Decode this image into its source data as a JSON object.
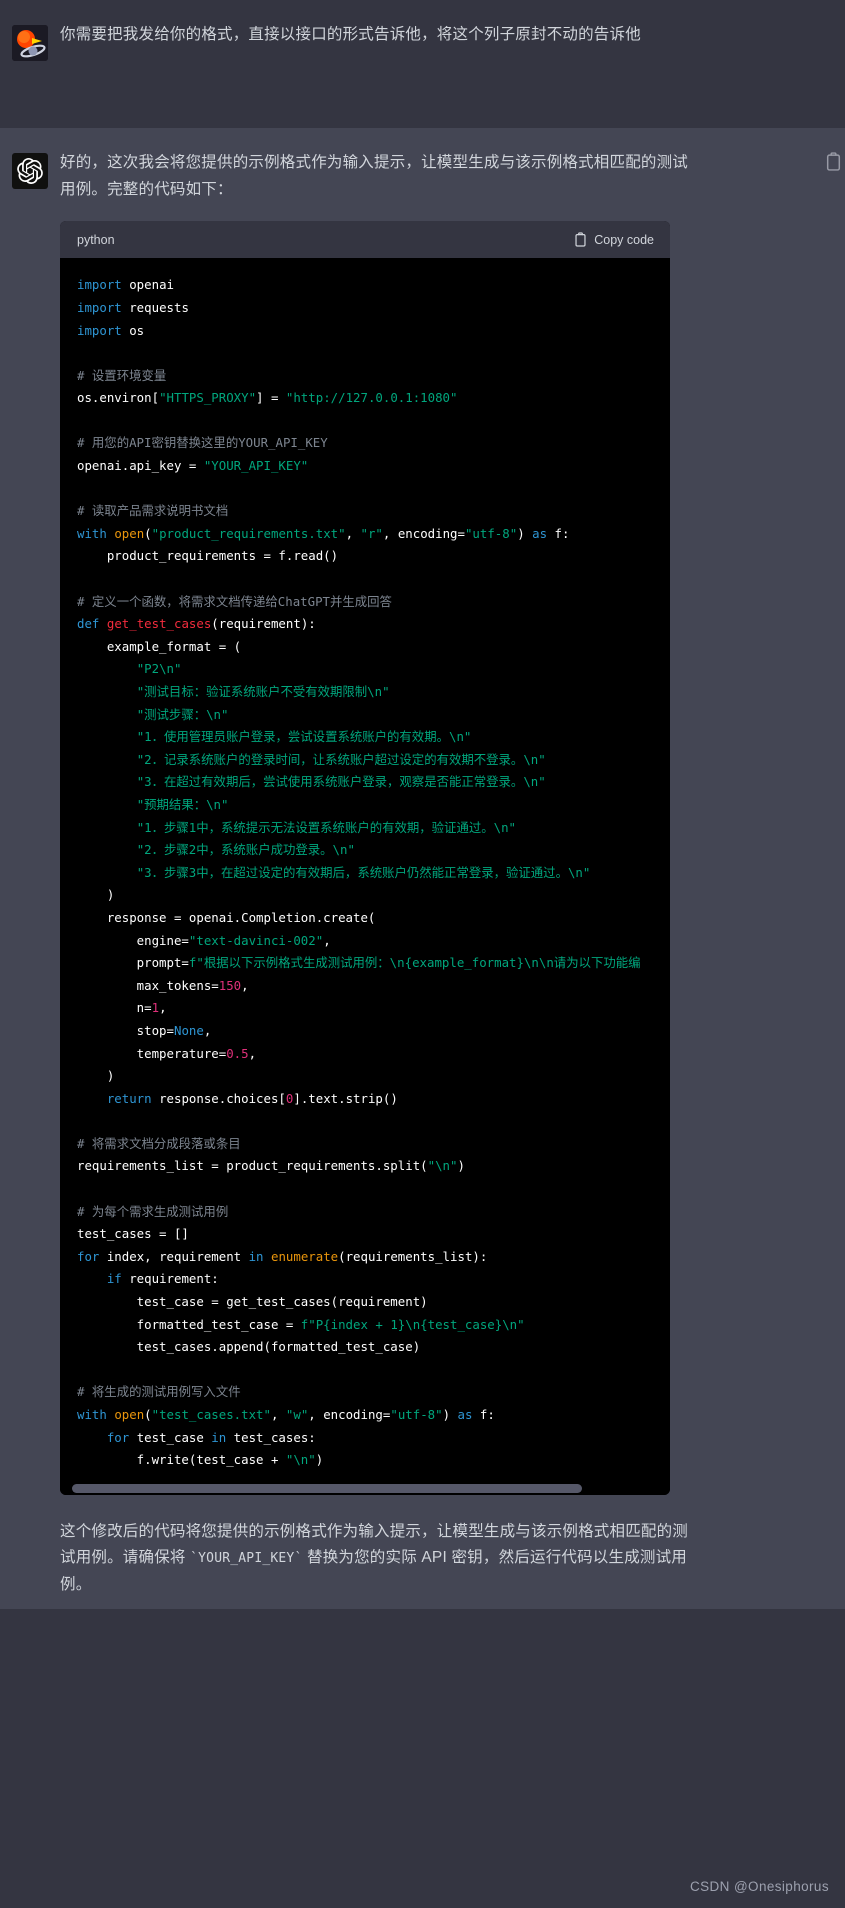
{
  "conversation": {
    "user_message": {
      "avatar_alt": "user-planet-avatar",
      "text": "你需要把我发给你的格式，直接以接口的形式告诉他，将这个列子原封不动的告诉他"
    },
    "assistant_message": {
      "avatar_alt": "openai-logo-avatar",
      "intro_text": "好的，这次我会将您提供的示例格式作为输入提示，让模型生成与该示例格式相匹配的测试用例。完整的代码如下：",
      "copy_icon": "clipboard-icon",
      "code_block": {
        "language": "python",
        "copy_label": "Copy code",
        "copy_icon": "clipboard-icon",
        "code_lines": [
          "import openai",
          "import requests",
          "import os",
          "",
          "# 设置环境变量",
          "os.environ[\"HTTPS_PROXY\"] = \"http://127.0.0.1:1080\"",
          "",
          "# 用您的API密钥替换这里的YOUR_API_KEY",
          "openai.api_key = \"YOUR_API_KEY\"",
          "",
          "# 读取产品需求说明书文档",
          "with open(\"product_requirements.txt\", \"r\", encoding=\"utf-8\") as f:",
          "    product_requirements = f.read()",
          "",
          "# 定义一个函数，将需求文档传递给ChatGPT并生成回答",
          "def get_test_cases(requirement):",
          "    example_format = (",
          "        \"P2\\n\"",
          "        \"测试目标：验证系统账户不受有效期限制\\n\"",
          "        \"测试步骤：\\n\"",
          "        \"1．使用管理员账户登录，尝试设置系统账户的有效期。\\n\"",
          "        \"2．记录系统账户的登录时间，让系统账户超过设定的有效期不登录。\\n\"",
          "        \"3．在超过有效期后，尝试使用系统账户登录，观察是否能正常登录。\\n\"",
          "        \"预期结果：\\n\"",
          "        \"1．步骤1中，系统提示无法设置系统账户的有效期，验证通过。\\n\"",
          "        \"2．步骤2中，系统账户成功登录。\\n\"",
          "        \"3．步骤3中，在超过设定的有效期后，系统账户仍然能正常登录，验证通过。\\n\"",
          "    )",
          "    response = openai.Completion.create(",
          "        engine=\"text-davinci-002\",",
          "        prompt=f\"根据以下示例格式生成测试用例：\\n{example_format}\\n\\n请为以下功能编",
          "        max_tokens=150,",
          "        n=1,",
          "        stop=None,",
          "        temperature=0.5,",
          "    )",
          "    return response.choices[0].text.strip()",
          "",
          "# 将需求文档分成段落或条目",
          "requirements_list = product_requirements.split(\"\\n\")",
          "",
          "# 为每个需求生成测试用例",
          "test_cases = []",
          "for index, requirement in enumerate(requirements_list):",
          "    if requirement:",
          "        test_case = get_test_cases(requirement)",
          "        formatted_test_case = f\"P{index + 1}\\n{test_case}\\n\"",
          "        test_cases.append(formatted_test_case)",
          "",
          "# 将生成的测试用例写入文件",
          "with open(\"test_cases.txt\", \"w\", encoding=\"utf-8\") as f:",
          "    for test_case in test_cases:",
          "        f.write(test_case + \"\\n\")"
        ]
      },
      "closing_text_part1": "这个修改后的代码将您提供的示例格式作为输入提示，让模型生成与该示例格式相匹配的测试用例。请确保将 ",
      "closing_inline_code": "`YOUR_API_KEY`",
      "closing_text_part2": " 替换为您的实际 API 密钥，然后运行代码以生成测试用例。"
    }
  },
  "watermark": "CSDN @Onesiphorus",
  "colors": {
    "user_bg": "#343541",
    "assistant_bg": "#444654",
    "code_bg": "#000000",
    "keyword": "#2e95d3",
    "string": "#00a67d",
    "comment": "#7d8590",
    "function": "#f22c3d",
    "builtin": "#e9950c",
    "number": "#df3079",
    "text": "#d1d5db"
  }
}
